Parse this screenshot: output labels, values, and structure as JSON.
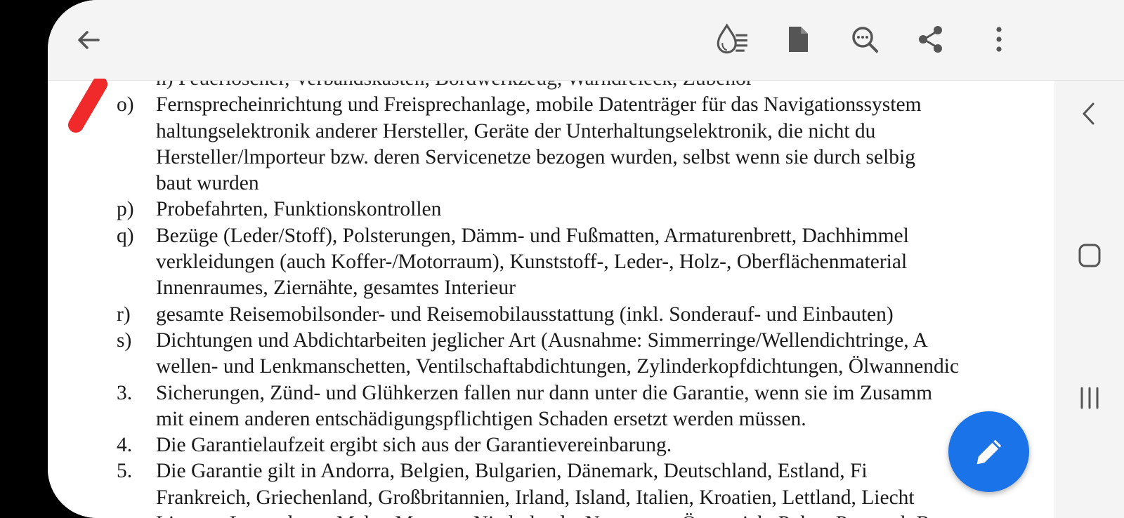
{
  "toolbar": {
    "back_icon": "arrow-left-icon",
    "actions": [
      "reading-mode-icon",
      "file-icon",
      "search-icon",
      "share-icon",
      "more-vert-icon"
    ]
  },
  "document": {
    "cut_top": "n)  Feuerlöscher, Verbandskasten, Bordwerkzeug, Warndreieck, Zubehör",
    "items": [
      {
        "marker": "o)",
        "lines": [
          "Fernsprecheinrichtung und Freisprechanlage, mobile Datenträger für das Navigationssystem",
          "haltungselektronik anderer Hersteller, Geräte der Unterhaltungselektronik, die nicht du",
          "Hersteller/lmporteur bzw. deren Servicenetze bezogen wurden, selbst wenn sie durch selbig",
          "baut wurden"
        ]
      },
      {
        "marker": "p)",
        "lines": [
          "Probefahrten, Funktionskontrollen"
        ]
      },
      {
        "marker": "q)",
        "lines": [
          "Bezüge (Leder/Stoff), Polsterungen, Dämm- und Fußmatten, Armaturenbrett, Dachhimmel",
          "verkleidungen (auch Koffer-/Motorraum), Kunststoff-, Leder-, Holz-, Oberflächenmaterial",
          "Innenraumes, Ziernähte, gesamtes Interieur"
        ]
      },
      {
        "marker": "r)",
        "lines": [
          "gesamte Reisemobilsonder- und Reisemobilausstattung (inkl. Sonderauf- und Einbauten)"
        ]
      },
      {
        "marker": "s)",
        "lines": [
          "Dichtungen und Abdichtarbeiten jeglicher Art (Ausnahme: Simmerringe/Wellendichtringe, A",
          "wellen- und Lenkmanschetten, Ventilschaftabdichtungen, Zylinderkopfdichtungen, Ölwannendic"
        ]
      },
      {
        "marker": "3.",
        "lines": [
          "Sicherungen, Zünd- und Glühkerzen fallen nur dann unter die Garantie, wenn sie im Zusamm",
          "mit einem anderen entschädigungspflichtigen Schaden ersetzt werden müssen."
        ]
      },
      {
        "marker": "4.",
        "lines": [
          "Die Garantielaufzeit ergibt sich aus der Garantievereinbarung."
        ]
      },
      {
        "marker": "5.",
        "lines": [
          "Die Garantie gilt in Andorra, Belgien, Bulgarien, Dänemark, Deutschland, Estland, Fi",
          "Frankreich, Griechenland, Großbritannien, Irland, Island, Italien, Kroatien, Lettland, Liecht",
          "Litauen, Luxemburg, Malta, Monaco, Niederlande, Norwegen, Österreich, Polen, Portugal, Ru"
        ]
      }
    ]
  },
  "nav_rail": [
    "back-chevron-icon",
    "home-square-icon",
    "recents-lines-icon"
  ],
  "fab": {
    "icon": "pencil-icon",
    "color": "#1a73e8"
  },
  "annotation": {
    "color": "#f02a2a"
  }
}
